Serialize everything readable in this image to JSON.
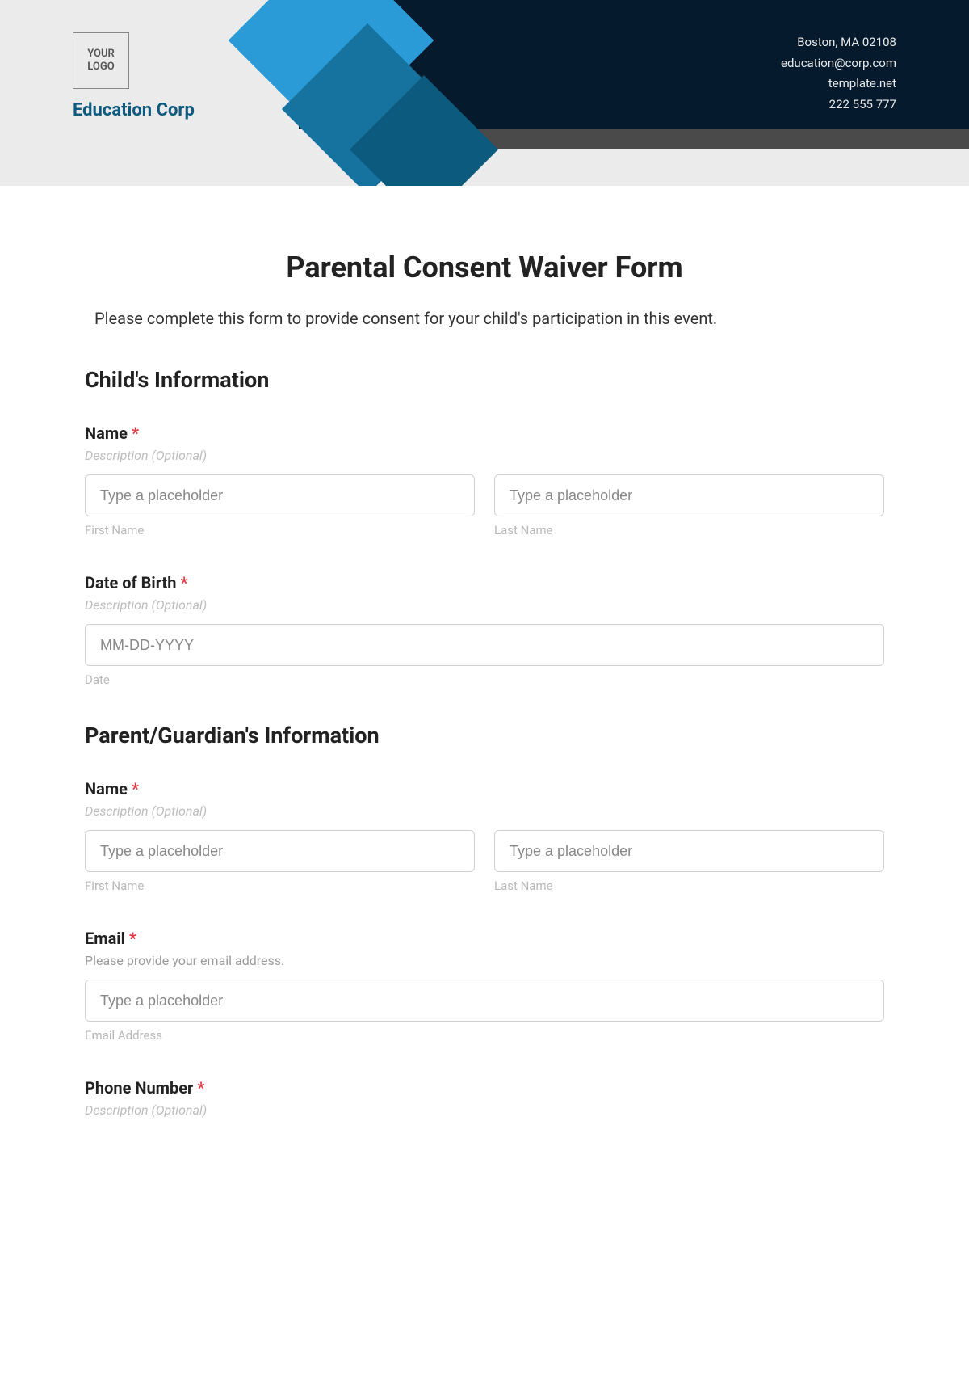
{
  "header": {
    "logo_text": "YOUR\nLOGO",
    "company_name": "Education Corp",
    "contact": {
      "address": "Boston, MA 02108",
      "email": "education@corp.com",
      "website": "template.net",
      "phone": "222 555 777"
    }
  },
  "form": {
    "title": "Parental Consent Waiver Form",
    "intro": "Please complete this form to provide consent for your child's participation in this event.",
    "sections": {
      "child": {
        "title": "Child's Information",
        "name": {
          "label": "Name",
          "desc": "Description (Optional)",
          "first_placeholder": "Type a placeholder",
          "first_sub": "First Name",
          "last_placeholder": "Type a placeholder",
          "last_sub": "Last Name"
        },
        "dob": {
          "label": "Date of Birth",
          "desc": "Description (Optional)",
          "placeholder": "MM-DD-YYYY",
          "sub": "Date"
        }
      },
      "parent": {
        "title": "Parent/Guardian's Information",
        "name": {
          "label": "Name",
          "desc": "Description (Optional)",
          "first_placeholder": "Type a placeholder",
          "first_sub": "First Name",
          "last_placeholder": "Type a placeholder",
          "last_sub": "Last Name"
        },
        "email": {
          "label": "Email",
          "desc": "Please provide your email address.",
          "placeholder": "Type a placeholder",
          "sub": "Email Address"
        },
        "phone": {
          "label": "Phone Number",
          "desc": "Description (Optional)"
        }
      }
    }
  }
}
